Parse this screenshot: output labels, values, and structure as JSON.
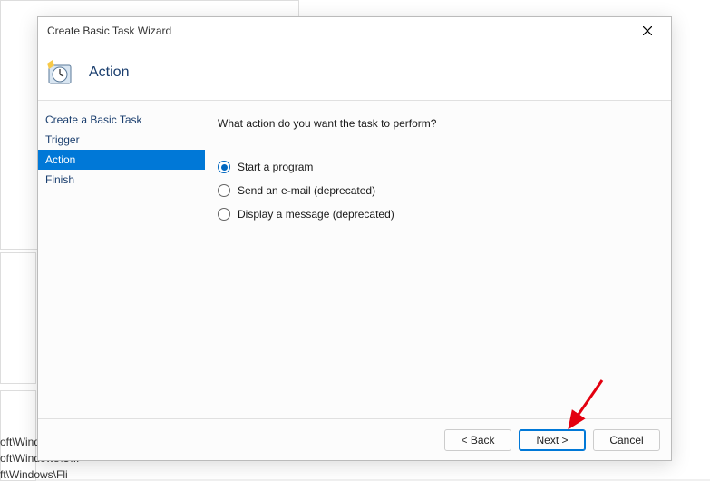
{
  "background": {
    "line1": "oft\\Windo",
    "line2": "oft\\Windows\\U...",
    "line3": "ft\\Windows\\Fli"
  },
  "dialog": {
    "title": "Create Basic Task Wizard",
    "header_title": "Action",
    "prompt": "What action do you want the task to perform?",
    "sidebar": [
      {
        "label": "Create a Basic Task",
        "selected": false
      },
      {
        "label": "Trigger",
        "selected": false
      },
      {
        "label": "Action",
        "selected": true
      },
      {
        "label": "Finish",
        "selected": false
      }
    ],
    "options": [
      {
        "label": "Start a program",
        "checked": true
      },
      {
        "label": "Send an e-mail (deprecated)",
        "checked": false
      },
      {
        "label": "Display a message (deprecated)",
        "checked": false
      }
    ],
    "buttons": {
      "back": "< Back",
      "next": "Next >",
      "cancel": "Cancel"
    }
  }
}
